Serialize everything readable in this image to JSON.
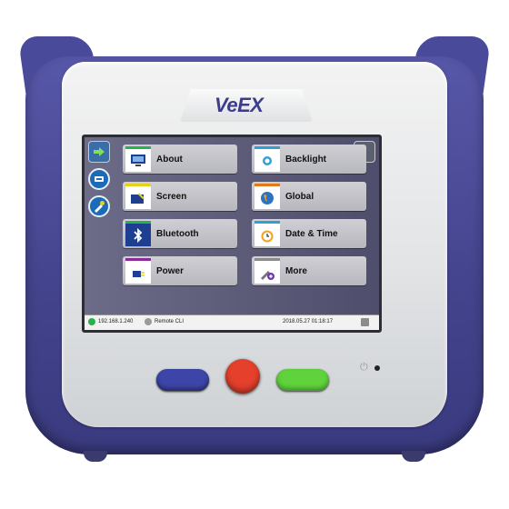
{
  "device": {
    "brand": "VeEX"
  },
  "colors": {
    "shell": "#4a4a9a",
    "stop_button": "#e4402c",
    "go_button": "#5fd23c",
    "home_button": "#3d46a8"
  },
  "sidebar": {
    "items": [
      {
        "icon": "arrow-right-icon"
      },
      {
        "icon": "network-icon"
      },
      {
        "icon": "tools-icon"
      }
    ]
  },
  "topright": {
    "icon": "back-icon"
  },
  "menu": {
    "tiles": [
      {
        "label": "About",
        "icon": "monitor-icon",
        "accent": "#27b34a"
      },
      {
        "label": "Backlight",
        "icon": "brightness-icon",
        "accent": "#2f9fd6"
      },
      {
        "label": "Screen",
        "icon": "screen-brush-icon",
        "accent": "#e6d11f"
      },
      {
        "label": "Global",
        "icon": "globe-icon",
        "accent": "#e07a1d"
      },
      {
        "label": "Bluetooth",
        "icon": "bluetooth-icon",
        "accent": "#27b34a"
      },
      {
        "label": "Date & Time",
        "icon": "alarm-clock-icon",
        "accent": "#2f9fd6"
      },
      {
        "label": "Power",
        "icon": "power-plug-icon",
        "accent": "#8b2b9a"
      },
      {
        "label": "More",
        "icon": "more-tools-icon",
        "accent": "#8b8b8b"
      }
    ]
  },
  "statusbar": {
    "ip": "192.168.1.240",
    "remote": "Remote CLI",
    "datetime": "2018.05.27  01:18:17"
  }
}
